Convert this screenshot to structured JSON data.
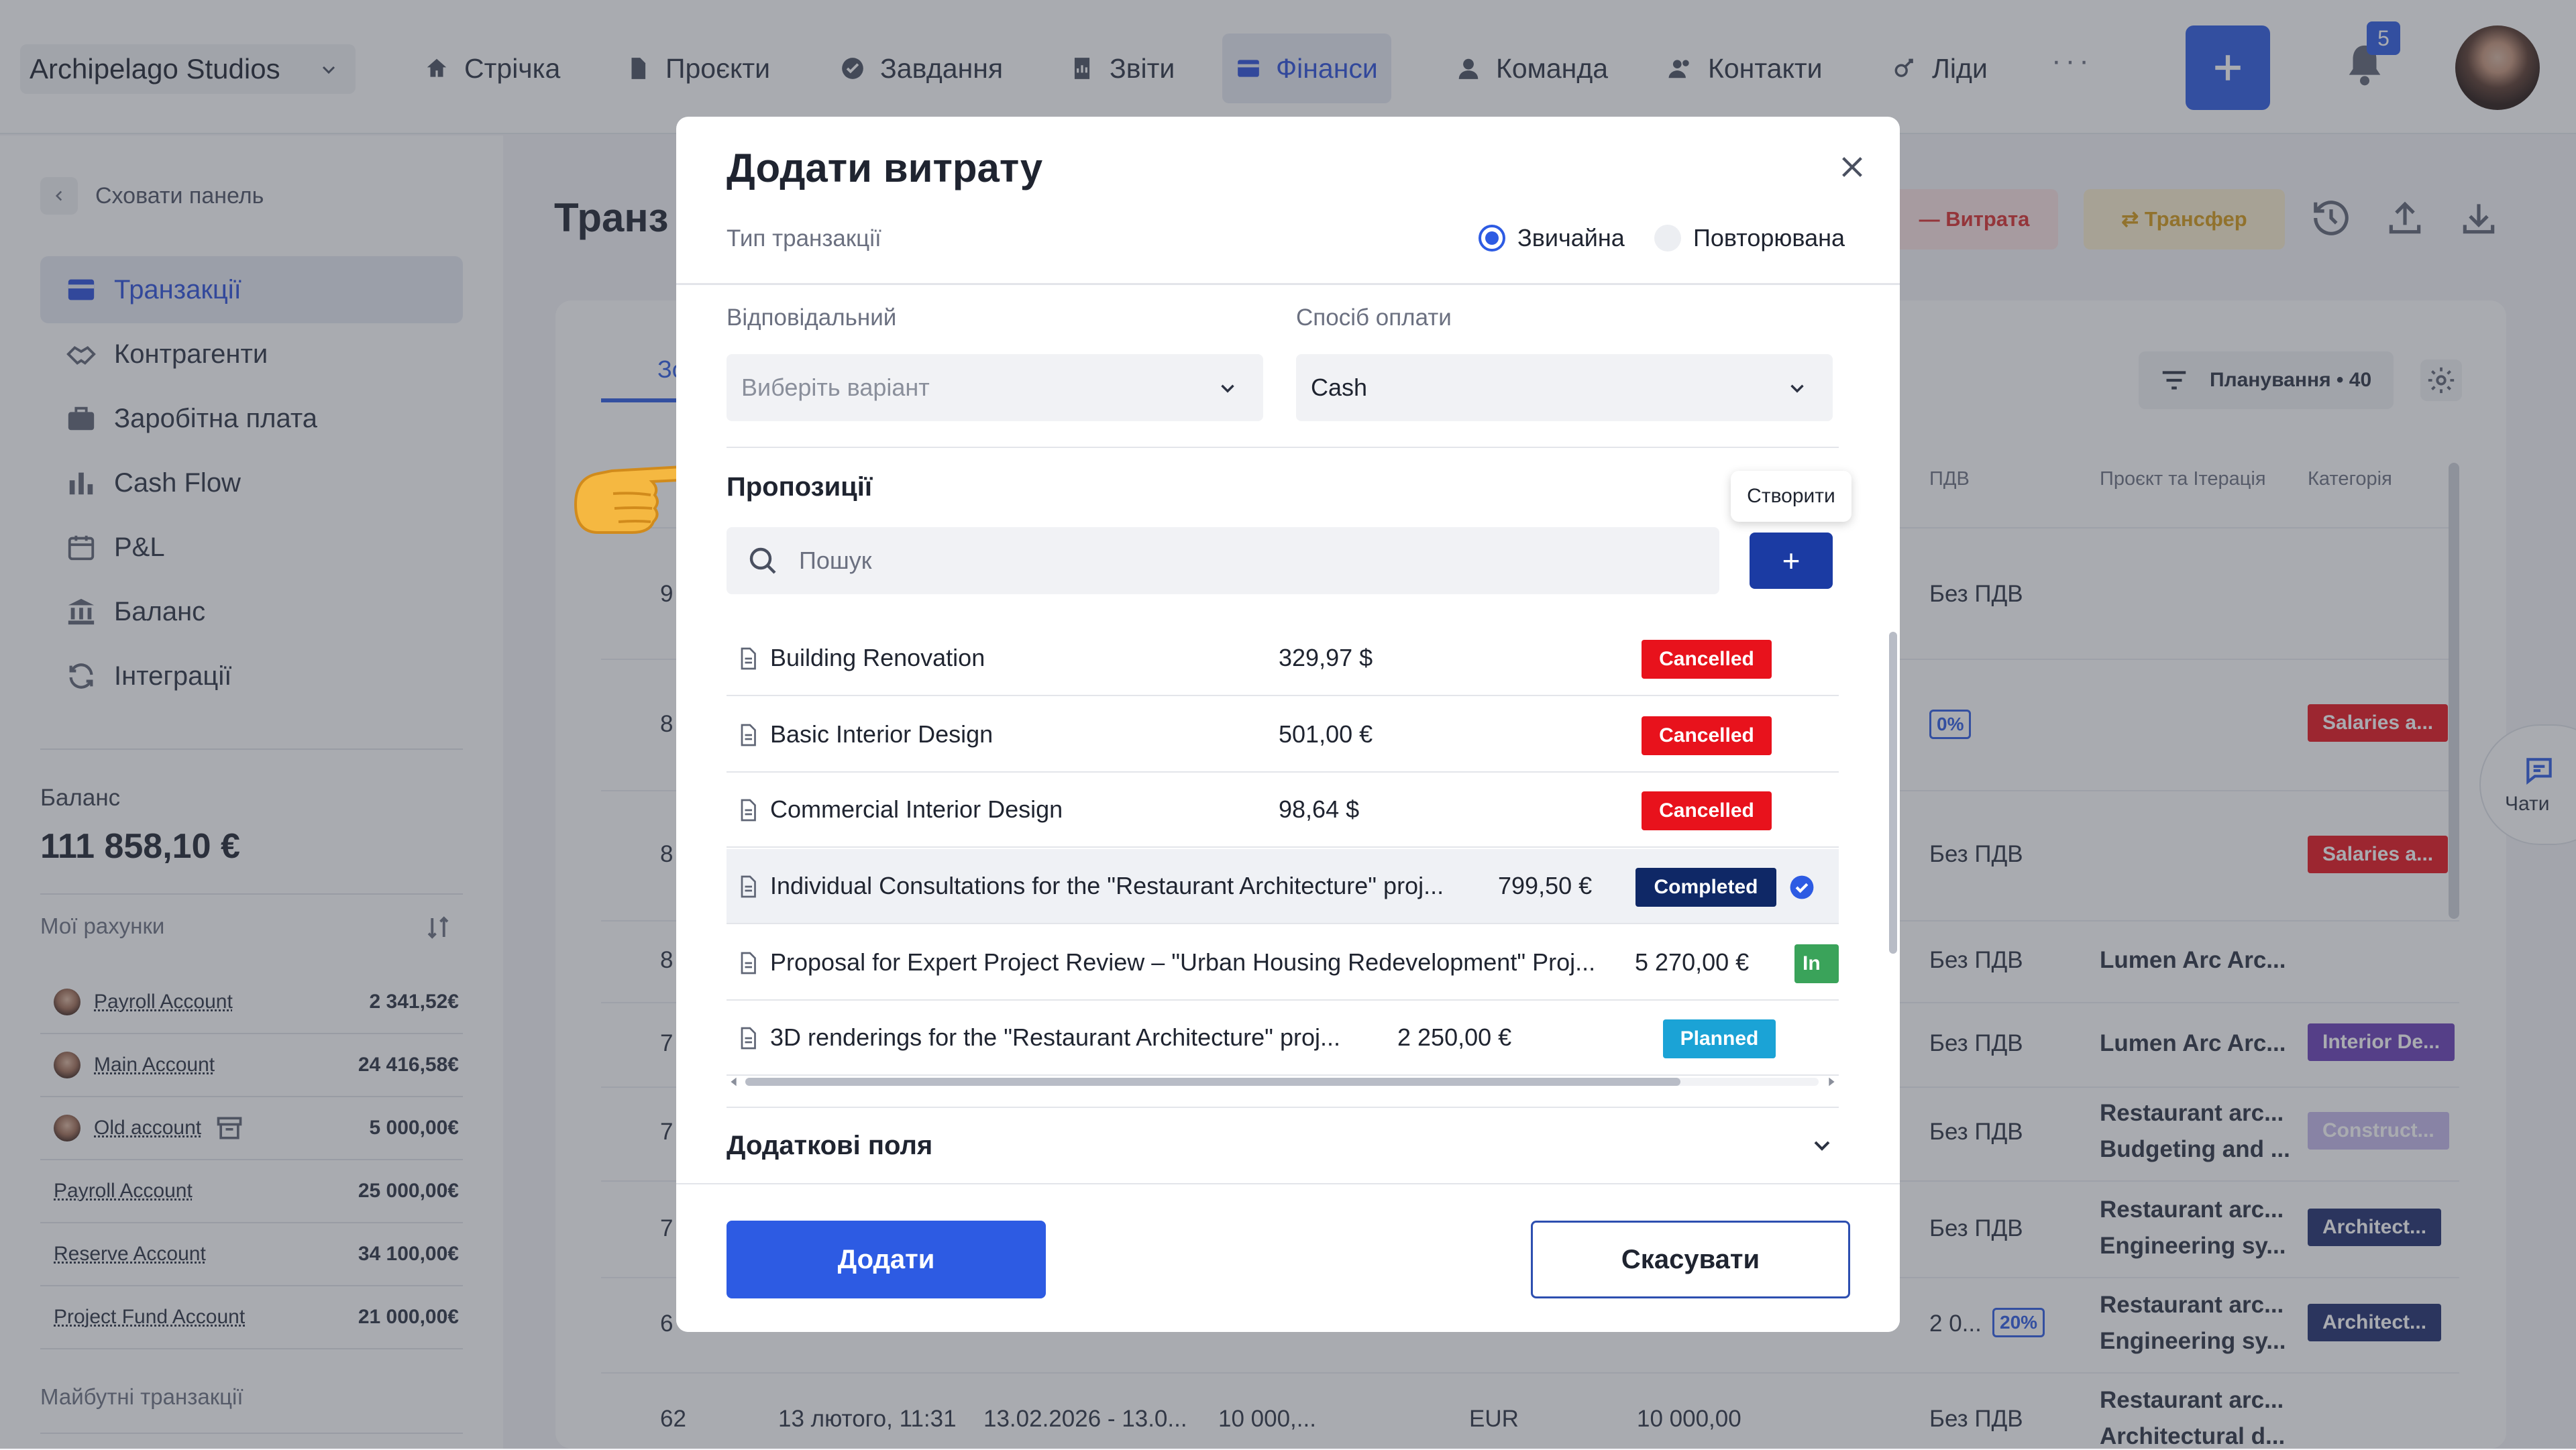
{
  "colors": {
    "accent": "#2d5be3",
    "danger": "#e8121c",
    "completed": "#0f2866",
    "in_progress": "#3aa35a",
    "planned": "#1ba3d6"
  },
  "topnav": {
    "company": "Archipelago Studios",
    "items": [
      {
        "label": "Стрічка",
        "icon": "home-icon"
      },
      {
        "label": "Проєкти",
        "icon": "document-icon"
      },
      {
        "label": "Завдання",
        "icon": "check-circle-icon"
      },
      {
        "label": "Звіти",
        "icon": "report-icon"
      },
      {
        "label": "Фінанси",
        "icon": "wallet-icon",
        "active": true
      },
      {
        "label": "Команда",
        "icon": "user-icon"
      },
      {
        "label": "Контакти",
        "icon": "contacts-icon"
      },
      {
        "label": "Ліди",
        "icon": "leads-icon"
      }
    ],
    "more": "···",
    "notifications": "5"
  },
  "sidebar": {
    "hide": "Сховати панель",
    "items": [
      {
        "label": "Транзакції",
        "icon": "card-icon",
        "active": true
      },
      {
        "label": "Контрагенти",
        "icon": "handshake-icon"
      },
      {
        "label": "Заробітна плата",
        "icon": "briefcase-icon"
      },
      {
        "label": "Cash Flow",
        "icon": "bar-chart-icon"
      },
      {
        "label": "P&L",
        "icon": "calendar-icon"
      },
      {
        "label": "Баланс",
        "icon": "bank-icon"
      },
      {
        "label": "Інтеграції",
        "icon": "sync-icon"
      }
    ],
    "balance_label": "Баланс",
    "balance_value": "111 858,10 €",
    "accounts_label": "Мої рахунки",
    "accounts": [
      {
        "name": "Payroll Account",
        "amount": "2 341,52€",
        "avatar": true
      },
      {
        "name": "Main Account",
        "amount": "24 416,58€",
        "avatar": true
      },
      {
        "name": "Old account",
        "amount": "5 000,00€",
        "avatar": true,
        "archived": true
      },
      {
        "name": "Payroll Account",
        "amount": "25 000,00€"
      },
      {
        "name": "Reserve Account",
        "amount": "34 100,00€"
      },
      {
        "name": "Project Fund Account",
        "amount": "21 000,00€"
      }
    ],
    "future": "Майбутні транзакції"
  },
  "main": {
    "title": "Транз",
    "tab": "Зо",
    "expense_btn": "— Витрата",
    "transfer_btn": "⇄ Трансфер",
    "planning": "Планування • 40",
    "columns": {
      "vat": "ПДВ",
      "project": "Проєкт та Ітерація",
      "category": "Категорія"
    },
    "rows": [
      {
        "num": "9",
        "vat": "Без ПДВ",
        "project": "",
        "project_sub": "",
        "category": ""
      },
      {
        "num": "8",
        "vat": "",
        "pct": "0%",
        "project": "",
        "project_sub": "",
        "category": "Salaries a..."
      },
      {
        "num": "8",
        "vat": "Без ПДВ",
        "project": "",
        "project_sub": "",
        "category": "Salaries a..."
      },
      {
        "num": "8",
        "vat": "Без ПДВ",
        "project": "Lumen Arc Arc...",
        "project_sub": "",
        "category": ""
      },
      {
        "num": "7",
        "vat": "Без ПДВ",
        "project": "Lumen Arc Arc...",
        "project_sub": "",
        "category": "Interior De..."
      },
      {
        "num": "7",
        "vat": "Без ПДВ",
        "project": "Restaurant arc...",
        "project_sub": "Budgeting and ...",
        "category": "Construct..."
      },
      {
        "num": "7",
        "vat": "Без ПДВ",
        "project": "Restaurant arc...",
        "project_sub": "Engineering sy...",
        "category": "Architect..."
      },
      {
        "num": "6",
        "vat": "2 0...",
        "pct": "20%",
        "project": "Restaurant arc...",
        "project_sub": "Engineering sy...",
        "category": "Architect..."
      },
      {
        "num": "62",
        "date": "13 лютого, 11:31",
        "period": "13.02.2026 - 13.0...",
        "amount": "10 000,...",
        "currency": "EUR",
        "amount2": "10 000,00",
        "vat": "Без ПДВ",
        "project": "Restaurant arc...",
        "project_sub": "Architectural d...",
        "category": ""
      }
    ],
    "chat": "Чати"
  },
  "modal": {
    "title": "Додати витрату",
    "type_label": "Тип транзакції",
    "type_options": [
      "Звичайна",
      "Повторювана"
    ],
    "responsible_label": "Відповідальний",
    "responsible_placeholder": "Виберіть варіант",
    "payment_label": "Спосіб оплати",
    "payment_value": "Cash",
    "proposals_title": "Пропозиції",
    "tooltip": "Створити",
    "search_placeholder": "Пошук",
    "add_symbol": "+",
    "proposals": [
      {
        "name": "Building Renovation",
        "amount": "329,97 $",
        "status": "Cancelled"
      },
      {
        "name": "Basic Interior Design",
        "amount": "501,00 €",
        "status": "Cancelled"
      },
      {
        "name": "Commercial Interior Design",
        "amount": "98,64 $",
        "status": "Cancelled"
      },
      {
        "name": "Individual Consultations for the \"Restaurant Architecture\" proj...",
        "amount": "799,50 €",
        "status": "Completed",
        "selected": true
      },
      {
        "name": "Proposal for Expert Project Review – \"Urban Housing Redevelopment\" Proj...",
        "amount": "5 270,00 €",
        "status": "In"
      },
      {
        "name": "3D renderings for the \"Restaurant Architecture\" proj...",
        "amount": "2 250,00 €",
        "status": "Planned"
      }
    ],
    "extra_fields": "Додаткові поля",
    "submit": "Додати",
    "cancel": "Скасувати"
  }
}
